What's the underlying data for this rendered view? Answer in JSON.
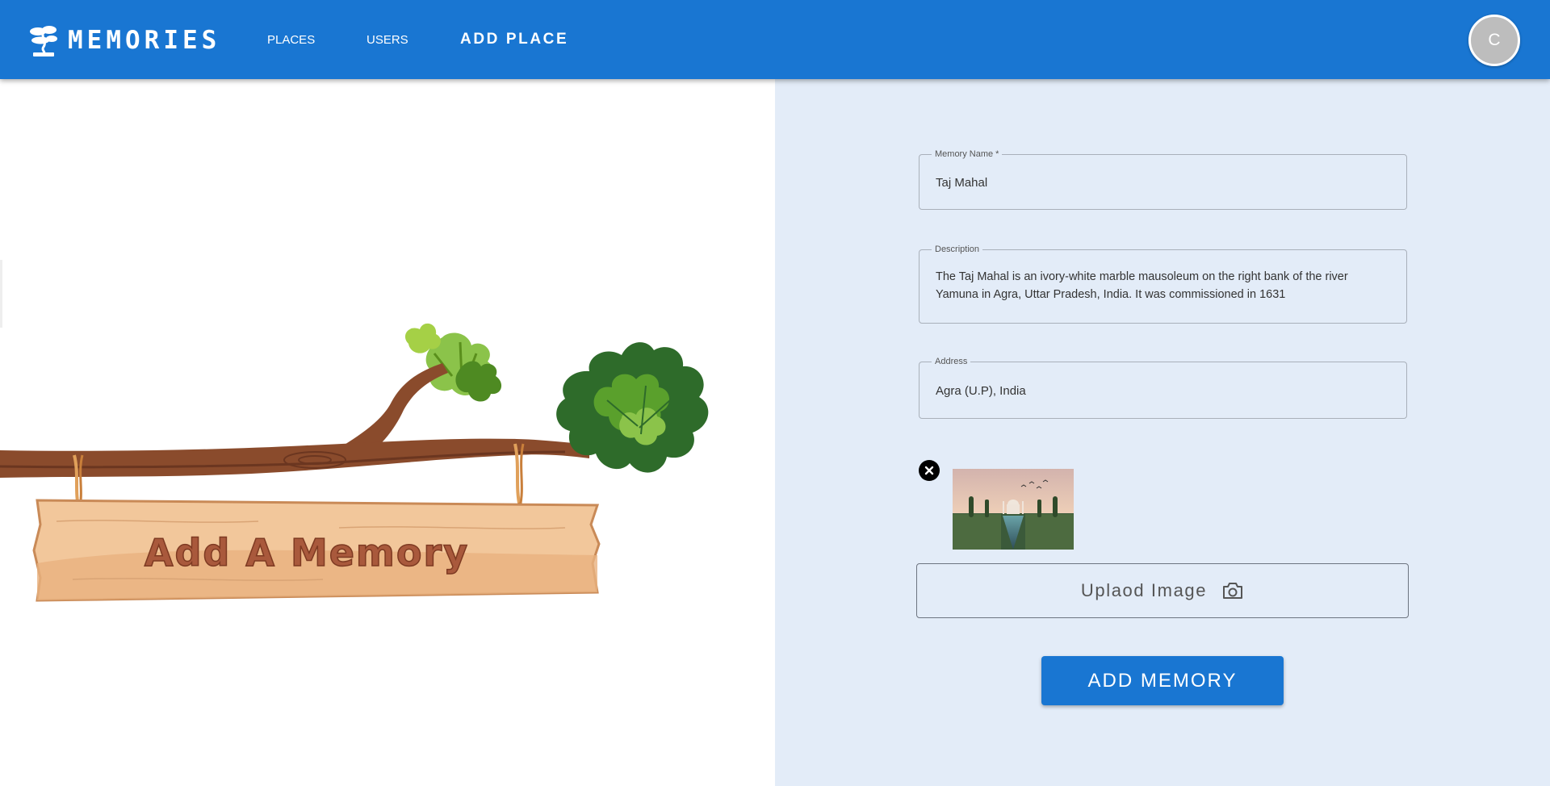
{
  "app": {
    "brand_name": "MEMORIES",
    "brand_icon": "bonsai-tree-icon",
    "accent_color": "#1976d2"
  },
  "nav": {
    "places": "PLACES",
    "users": "USERS",
    "add_place": "ADD PLACE"
  },
  "user": {
    "avatar_initial": "C"
  },
  "illustration": {
    "sign_text": "Add A Memory"
  },
  "form": {
    "memory_name": {
      "label": "Memory Name *",
      "value": "Taj Mahal"
    },
    "description": {
      "label": "Description",
      "value": "The Taj Mahal is an ivory-white marble mausoleum on the right bank of the river Yamuna in Agra, Uttar Pradesh, India. It was commissioned in 1631"
    },
    "address": {
      "label": "Address",
      "value": "Agra (U.P), India"
    },
    "remove_icon": "close-circle-icon",
    "upload_label": "Uplaod Image",
    "upload_icon": "camera-icon",
    "submit_label": "ADD MEMORY"
  }
}
